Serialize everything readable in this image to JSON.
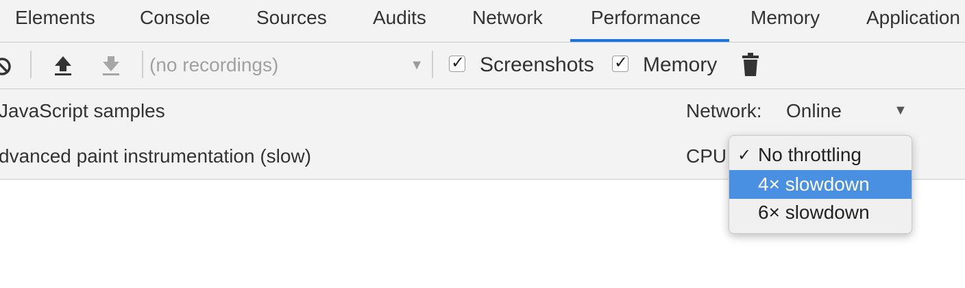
{
  "tabs": [
    {
      "label": "Elements"
    },
    {
      "label": "Console"
    },
    {
      "label": "Sources"
    },
    {
      "label": "Audits"
    },
    {
      "label": "Network"
    },
    {
      "label": "Performance",
      "active": true
    },
    {
      "label": "Memory"
    },
    {
      "label": "Application"
    }
  ],
  "toolbar": {
    "recordings_placeholder": "(no recordings)",
    "screenshots_label": "Screenshots",
    "screenshots_checked": true,
    "memory_label": "Memory",
    "memory_checked": true,
    "icons": [
      "clear-icon",
      "upload-icon",
      "download-icon",
      "trash-icon"
    ]
  },
  "settings": {
    "js_samples_label": "JavaScript samples",
    "paint_label": "dvanced paint instrumentation (slow)",
    "network_label": "Network:",
    "network_value": "Online",
    "cpu_label": "CPU"
  },
  "cpu_menu": {
    "options": [
      "No throttling",
      "4× slowdown",
      "6× slowdown"
    ],
    "selected": "No throttling",
    "highlighted": "4× slowdown",
    "check_glyph": "✓"
  },
  "colors": {
    "accent": "#1a73e8",
    "menu_highlight": "#4a90e2",
    "panel_bg": "#f3f3f3"
  }
}
